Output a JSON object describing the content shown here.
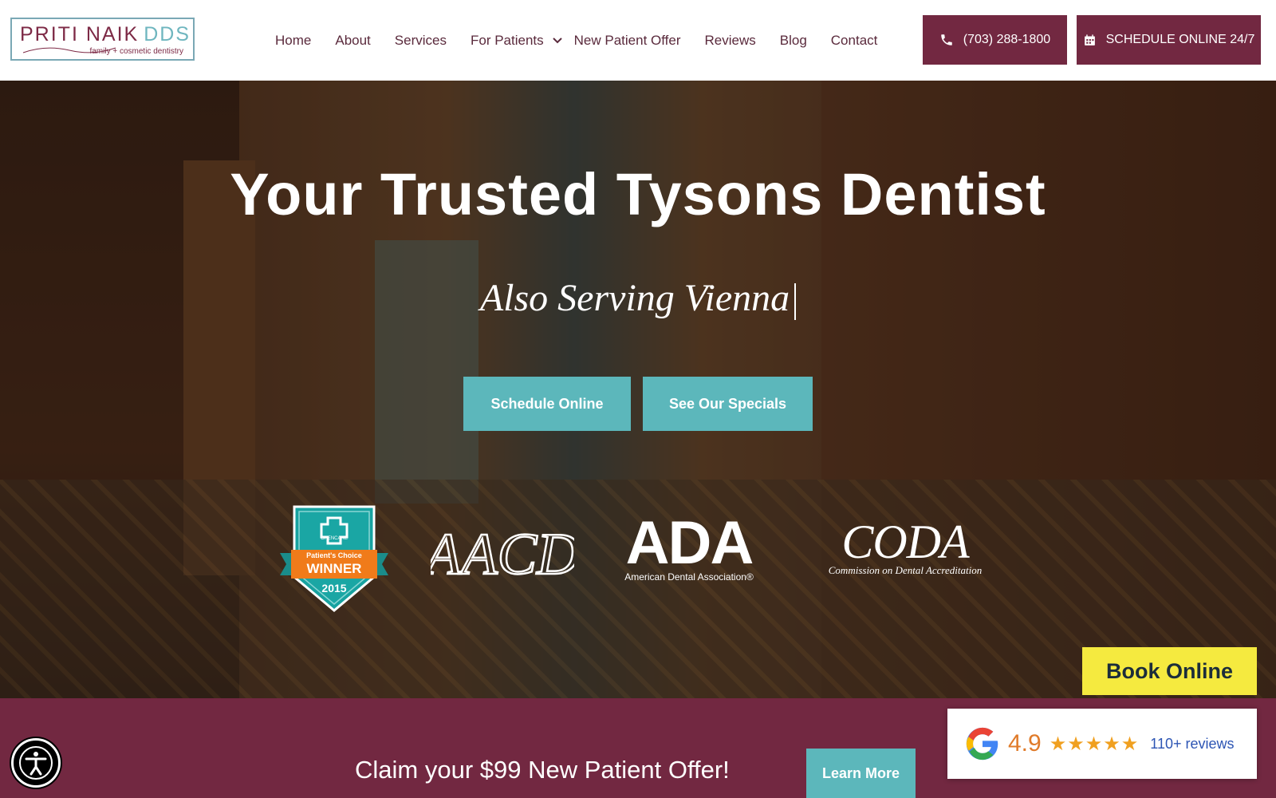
{
  "brand": {
    "name": "PRITI NAIK",
    "suffix": "DDS",
    "tagline": "family + cosmetic dentistry",
    "color_primary": "#722841",
    "color_accent": "#5cb7bb"
  },
  "nav": {
    "items": [
      {
        "label": "Home"
      },
      {
        "label": "About"
      },
      {
        "label": "Services"
      },
      {
        "label": "For Patients",
        "has_dropdown": true
      },
      {
        "label": "New Patient Offer"
      },
      {
        "label": "Reviews"
      },
      {
        "label": "Blog"
      },
      {
        "label": "Contact"
      }
    ]
  },
  "header_buttons": {
    "phone": {
      "label": "(703) 288-1800",
      "icon": "phone-icon"
    },
    "schedule": {
      "label": "SCHEDULE ONLINE 24/7",
      "icon": "calendar-icon"
    }
  },
  "hero": {
    "title": "Your Trusted Tysons Dentist",
    "subtitle": "Also Serving Vienna",
    "buttons": {
      "schedule": "Schedule Online",
      "specials": "See Our Specials"
    },
    "badges": {
      "winner": {
        "brand": "OPENCARE",
        "line1": "Patient's Choice",
        "line2": "WINNER",
        "year": "2015"
      },
      "aacd": {
        "text": "AACD"
      },
      "ada": {
        "text": "ADA",
        "sub": "American Dental Association®"
      },
      "coda": {
        "text": "CODA",
        "sub": "Commission on Dental Accreditation"
      }
    }
  },
  "book_online": {
    "label": "Book Online",
    "color": "#f5ea3f"
  },
  "offer": {
    "text": "Claim your $99 New Patient Offer!",
    "button": "Learn More"
  },
  "accessibility": {
    "icon": "accessibility-icon"
  },
  "reviews_widget": {
    "score": "4.9",
    "stars": "★★★★★",
    "count": "110+ reviews",
    "icon": "google-icon"
  }
}
